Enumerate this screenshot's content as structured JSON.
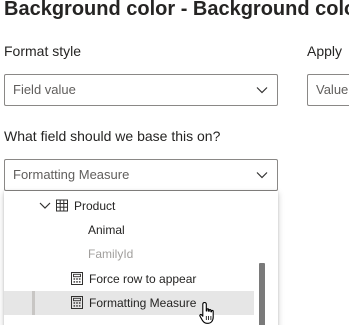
{
  "header": {
    "title": "Background color - Background color"
  },
  "format_style": {
    "label": "Format style",
    "value": "Field value"
  },
  "apply_to": {
    "label": "Apply",
    "value": "Value"
  },
  "base_field": {
    "label": "What field should we base this on?",
    "value": "Formatting Measure"
  },
  "field_list": {
    "table_name": "Product",
    "items": [
      {
        "label": "Animal",
        "type": "column",
        "state": "enabled"
      },
      {
        "label": "FamilyId",
        "type": "column",
        "state": "disabled"
      },
      {
        "label": "Force row to appear",
        "type": "measure",
        "state": "enabled"
      },
      {
        "label": "Formatting Measure",
        "type": "measure",
        "state": "hovered"
      }
    ]
  },
  "colors": {
    "disabled_text": "#a19f9d",
    "hover_row": "#e6e6e6",
    "border": "#8a8886"
  }
}
